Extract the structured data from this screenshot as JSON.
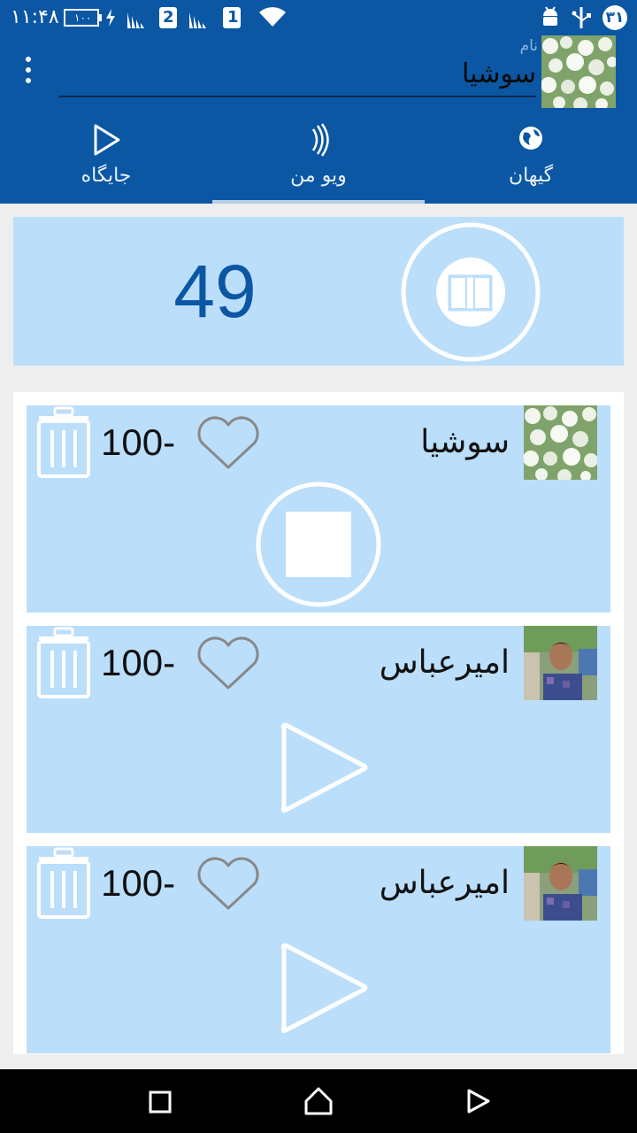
{
  "status_bar": {
    "time": "۱۱:۴۸",
    "battery": "۱۰۰",
    "sim1": "2",
    "sim2": "1",
    "notification_count": "۳۱",
    "icons": [
      "battery-icon",
      "charging-icon",
      "signal-icon",
      "wifi-icon",
      "android-icon",
      "usb-icon"
    ]
  },
  "header": {
    "name_label": "نام",
    "name_value": "سوشیا"
  },
  "tabs": [
    {
      "label": "جایگاه",
      "icon": "play-outline-icon"
    },
    {
      "label": "ویو من",
      "icon": "sound-wave-icon",
      "selected": true
    },
    {
      "label": "گیهان",
      "icon": "globe-icon"
    }
  ],
  "counter": {
    "value": "49",
    "control": "pause-icon"
  },
  "items": [
    {
      "user": "سوشیا",
      "score": "100-",
      "state": "playing",
      "control": "stop-icon",
      "avatar": "flowers-photo"
    },
    {
      "user": "امیرعباس",
      "score": "100-",
      "state": "stopped",
      "control": "play-icon",
      "avatar": "boy-photo"
    },
    {
      "user": "امیرعباس",
      "score": "100-",
      "state": "stopped",
      "control": "play-icon",
      "avatar": "boy-photo"
    }
  ],
  "colors": {
    "primary": "#0b57a4",
    "card": "#bbdefa",
    "background": "#eeeeee"
  }
}
